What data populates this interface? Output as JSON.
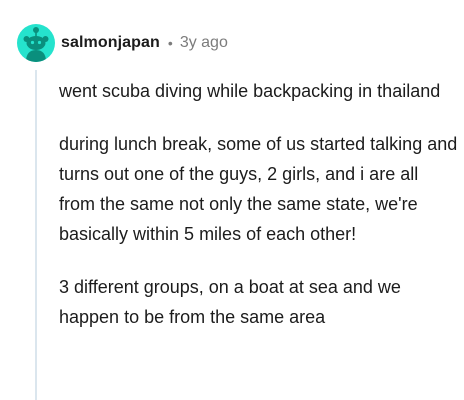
{
  "comment": {
    "avatar_icon": "reddit-snoo-avatar-icon",
    "avatar_color": "#25e3cd",
    "username": "salmonjapan",
    "separator": "•",
    "timestamp": "3y ago",
    "paragraphs": [
      "went scuba diving while backpacking in thailand",
      "during lunch break, some of us started talking and turns out one of the guys, 2 girls, and i are all from the same not only the same state, we're basically within 5 miles of each other!",
      "3 different groups, on a boat at sea and we happen to be from the same area"
    ]
  }
}
